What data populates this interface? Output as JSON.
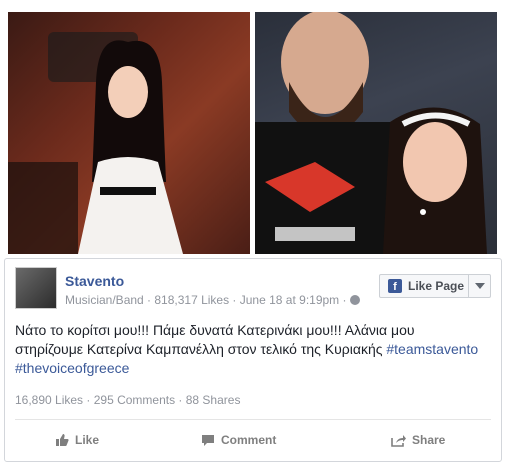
{
  "post": {
    "page_name": "Stavento",
    "meta": "Musician/Band · 818,317 Likes · June 18 at 9:19pm ·",
    "like_page_label": "Like Page",
    "text_line1": "Νάτο το κορίτσι μου!!! Πάμε δυνατά Κατερινάκι μου!!! Αλάνια μου",
    "text_line2_plain": "στηρίζουμε Κατερίνα Καμπανέλλη στον τελικό της Κυριακής ",
    "hashtag1": "#teamstavento",
    "hashtag2": "#thevoiceofgreece",
    "stats": "16,890 Likes · 295 Comments · 88 Shares"
  },
  "actions": {
    "like": "Like",
    "comment": "Comment",
    "share": "Share"
  },
  "colors": {
    "link": "#3b5998",
    "muted": "#90949c",
    "text": "#1d2129"
  }
}
